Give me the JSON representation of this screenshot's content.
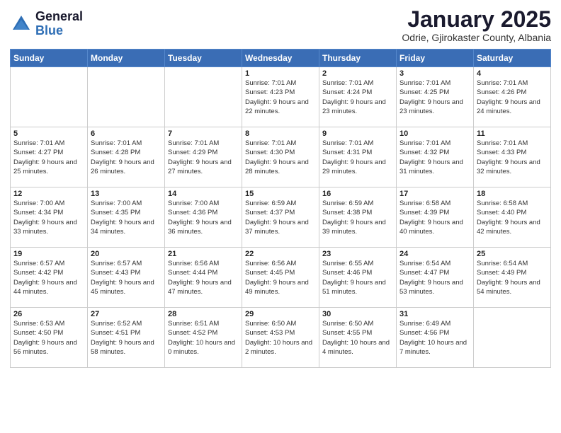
{
  "header": {
    "logo_general": "General",
    "logo_blue": "Blue",
    "month_title": "January 2025",
    "subtitle": "Odrie, Gjirokaster County, Albania"
  },
  "days_of_week": [
    "Sunday",
    "Monday",
    "Tuesday",
    "Wednesday",
    "Thursday",
    "Friday",
    "Saturday"
  ],
  "weeks": [
    [
      {
        "day": "",
        "info": ""
      },
      {
        "day": "",
        "info": ""
      },
      {
        "day": "",
        "info": ""
      },
      {
        "day": "1",
        "info": "Sunrise: 7:01 AM\nSunset: 4:23 PM\nDaylight: 9 hours and 22 minutes."
      },
      {
        "day": "2",
        "info": "Sunrise: 7:01 AM\nSunset: 4:24 PM\nDaylight: 9 hours and 23 minutes."
      },
      {
        "day": "3",
        "info": "Sunrise: 7:01 AM\nSunset: 4:25 PM\nDaylight: 9 hours and 23 minutes."
      },
      {
        "day": "4",
        "info": "Sunrise: 7:01 AM\nSunset: 4:26 PM\nDaylight: 9 hours and 24 minutes."
      }
    ],
    [
      {
        "day": "5",
        "info": "Sunrise: 7:01 AM\nSunset: 4:27 PM\nDaylight: 9 hours and 25 minutes."
      },
      {
        "day": "6",
        "info": "Sunrise: 7:01 AM\nSunset: 4:28 PM\nDaylight: 9 hours and 26 minutes."
      },
      {
        "day": "7",
        "info": "Sunrise: 7:01 AM\nSunset: 4:29 PM\nDaylight: 9 hours and 27 minutes."
      },
      {
        "day": "8",
        "info": "Sunrise: 7:01 AM\nSunset: 4:30 PM\nDaylight: 9 hours and 28 minutes."
      },
      {
        "day": "9",
        "info": "Sunrise: 7:01 AM\nSunset: 4:31 PM\nDaylight: 9 hours and 29 minutes."
      },
      {
        "day": "10",
        "info": "Sunrise: 7:01 AM\nSunset: 4:32 PM\nDaylight: 9 hours and 31 minutes."
      },
      {
        "day": "11",
        "info": "Sunrise: 7:01 AM\nSunset: 4:33 PM\nDaylight: 9 hours and 32 minutes."
      }
    ],
    [
      {
        "day": "12",
        "info": "Sunrise: 7:00 AM\nSunset: 4:34 PM\nDaylight: 9 hours and 33 minutes."
      },
      {
        "day": "13",
        "info": "Sunrise: 7:00 AM\nSunset: 4:35 PM\nDaylight: 9 hours and 34 minutes."
      },
      {
        "day": "14",
        "info": "Sunrise: 7:00 AM\nSunset: 4:36 PM\nDaylight: 9 hours and 36 minutes."
      },
      {
        "day": "15",
        "info": "Sunrise: 6:59 AM\nSunset: 4:37 PM\nDaylight: 9 hours and 37 minutes."
      },
      {
        "day": "16",
        "info": "Sunrise: 6:59 AM\nSunset: 4:38 PM\nDaylight: 9 hours and 39 minutes."
      },
      {
        "day": "17",
        "info": "Sunrise: 6:58 AM\nSunset: 4:39 PM\nDaylight: 9 hours and 40 minutes."
      },
      {
        "day": "18",
        "info": "Sunrise: 6:58 AM\nSunset: 4:40 PM\nDaylight: 9 hours and 42 minutes."
      }
    ],
    [
      {
        "day": "19",
        "info": "Sunrise: 6:57 AM\nSunset: 4:42 PM\nDaylight: 9 hours and 44 minutes."
      },
      {
        "day": "20",
        "info": "Sunrise: 6:57 AM\nSunset: 4:43 PM\nDaylight: 9 hours and 45 minutes."
      },
      {
        "day": "21",
        "info": "Sunrise: 6:56 AM\nSunset: 4:44 PM\nDaylight: 9 hours and 47 minutes."
      },
      {
        "day": "22",
        "info": "Sunrise: 6:56 AM\nSunset: 4:45 PM\nDaylight: 9 hours and 49 minutes."
      },
      {
        "day": "23",
        "info": "Sunrise: 6:55 AM\nSunset: 4:46 PM\nDaylight: 9 hours and 51 minutes."
      },
      {
        "day": "24",
        "info": "Sunrise: 6:54 AM\nSunset: 4:47 PM\nDaylight: 9 hours and 53 minutes."
      },
      {
        "day": "25",
        "info": "Sunrise: 6:54 AM\nSunset: 4:49 PM\nDaylight: 9 hours and 54 minutes."
      }
    ],
    [
      {
        "day": "26",
        "info": "Sunrise: 6:53 AM\nSunset: 4:50 PM\nDaylight: 9 hours and 56 minutes."
      },
      {
        "day": "27",
        "info": "Sunrise: 6:52 AM\nSunset: 4:51 PM\nDaylight: 9 hours and 58 minutes."
      },
      {
        "day": "28",
        "info": "Sunrise: 6:51 AM\nSunset: 4:52 PM\nDaylight: 10 hours and 0 minutes."
      },
      {
        "day": "29",
        "info": "Sunrise: 6:50 AM\nSunset: 4:53 PM\nDaylight: 10 hours and 2 minutes."
      },
      {
        "day": "30",
        "info": "Sunrise: 6:50 AM\nSunset: 4:55 PM\nDaylight: 10 hours and 4 minutes."
      },
      {
        "day": "31",
        "info": "Sunrise: 6:49 AM\nSunset: 4:56 PM\nDaylight: 10 hours and 7 minutes."
      },
      {
        "day": "",
        "info": ""
      }
    ]
  ]
}
